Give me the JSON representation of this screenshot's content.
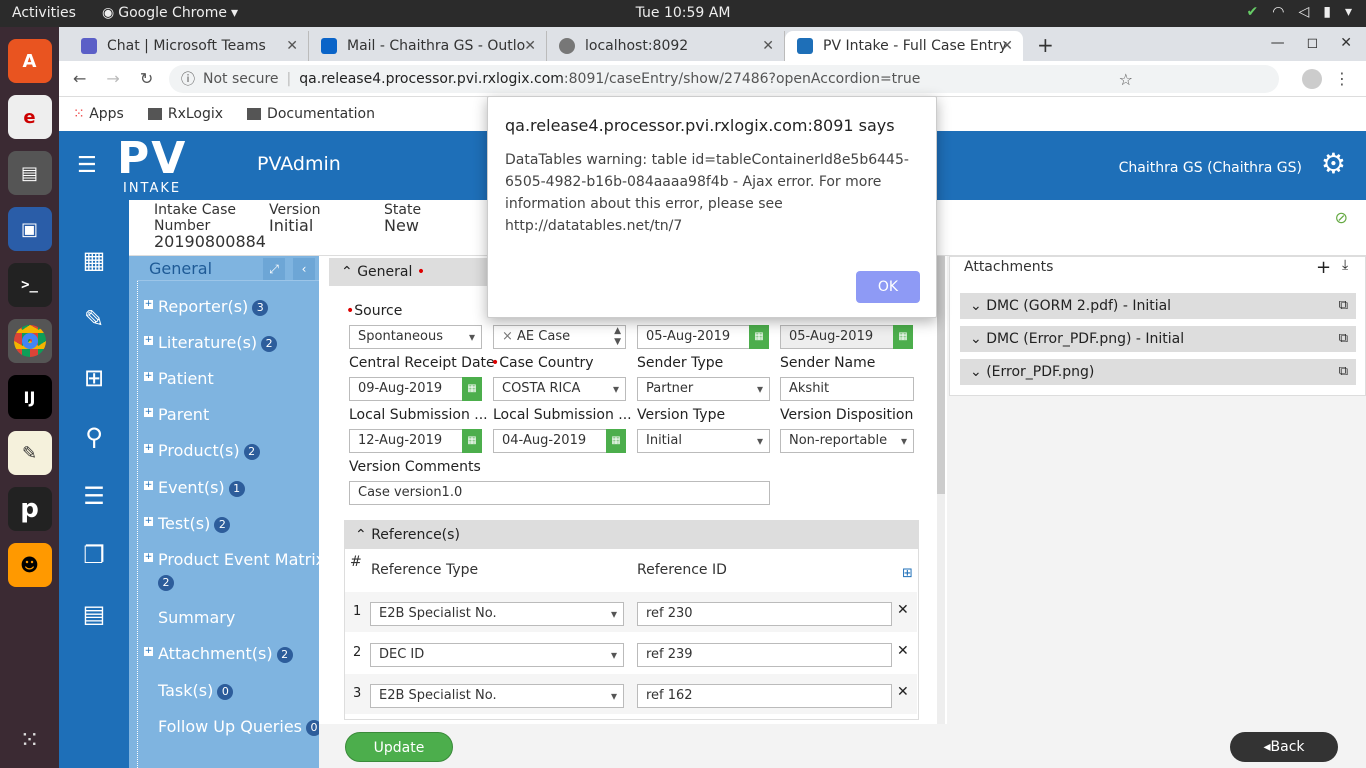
{
  "os": {
    "activities": "Activities",
    "app_name": "Google Chrome",
    "clock": "Tue 10:59 AM"
  },
  "tabs": [
    {
      "label": "Chat | Microsoft Teams"
    },
    {
      "label": "Mail - Chaithra GS - Outlo"
    },
    {
      "label": "localhost:8092"
    },
    {
      "label": "PV Intake - Full Case Entry"
    }
  ],
  "address": {
    "security": "Not secure",
    "url_host": "qa.release4.processor.pvi.rxlogix.com",
    "url_path": ":8091/caseEntry/show/27486?openAccordion=true"
  },
  "bookmarks": [
    "Apps",
    "RxLogix",
    "Documentation"
  ],
  "header": {
    "logo_text": "PV",
    "logo_sub": "INTAKE",
    "app_title": "PVAdmin",
    "user": "Chaithra GS (Chaithra GS)"
  },
  "caseinfo": {
    "intake_label": "Intake Case",
    "intake_label2": "Number",
    "intake_value": "20190800884",
    "version_label": "Version",
    "version_value": "Initial",
    "state_label": "State",
    "state_value": "New"
  },
  "secnav": {
    "title": "General",
    "items": [
      {
        "label": "Reporter(s)",
        "badge": "3"
      },
      {
        "label": "Literature(s)",
        "badge": "2"
      },
      {
        "label": "Patient",
        "badge": ""
      },
      {
        "label": "Parent",
        "badge": ""
      },
      {
        "label": "Product(s)",
        "badge": "2"
      },
      {
        "label": "Event(s)",
        "badge": "1"
      },
      {
        "label": "Test(s)",
        "badge": "2"
      },
      {
        "label": "Product Event Matrix",
        "badge": "2"
      },
      {
        "label": "Summary",
        "badge": ""
      },
      {
        "label": "Attachment(s)",
        "badge": "2"
      },
      {
        "label": "Task(s)",
        "badge": "0"
      },
      {
        "label": "Follow Up Queries",
        "badge": "0"
      }
    ]
  },
  "general": {
    "title": "General",
    "source_label": "Source",
    "source_value": "Spontaneous",
    "category_chip": "AE Case",
    "date1": "05-Aug-2019",
    "date2": "05-Aug-2019",
    "central_receipt_label": "Central Receipt Date",
    "central_receipt_value": "09-Aug-2019",
    "case_country_label": "Case Country",
    "case_country_value": "COSTA RICA",
    "sender_type_label": "Sender Type",
    "sender_type_value": "Partner",
    "sender_name_label": "Sender Name",
    "sender_name_value": "Akshit",
    "local_sub1_label": "Local Submission ...",
    "local_sub1_value": "12-Aug-2019",
    "local_sub2_label": "Local Submission ...",
    "local_sub2_value": "04-Aug-2019",
    "version_type_label": "Version Type",
    "version_type_value": "Initial",
    "version_disp_label": "Version Disposition",
    "version_disp_value": "Non-reportable",
    "version_comments_label": "Version Comments",
    "version_comments_value": "Case version1.0"
  },
  "references": {
    "title": "Reference(s)",
    "col_num": "#",
    "col_type": "Reference Type",
    "col_id": "Reference ID",
    "rows": [
      {
        "n": "1",
        "type": "E2B Specialist No.",
        "id": "ref 230"
      },
      {
        "n": "2",
        "type": "DEC ID",
        "id": "ref 239"
      },
      {
        "n": "3",
        "type": "E2B Specialist No.",
        "id": "ref 162"
      }
    ]
  },
  "attachments": {
    "title": "Attachments",
    "items": [
      {
        "label": "DMC (GORM 2.pdf) - Initial"
      },
      {
        "label": "DMC (Error_PDF.png) - Initial"
      },
      {
        "label": "(Error_PDF.png)"
      }
    ]
  },
  "footer": {
    "update": "Update",
    "back": "Back"
  },
  "dialog": {
    "title": "qa.release4.processor.pvi.rxlogix.com:8091 says",
    "message": "DataTables warning: table id=tableContainerId8e5b6445-6505-4982-b16b-084aaaa98f4b - Ajax error. For more information about this error, please see http://datatables.net/tn/7",
    "ok": "OK"
  }
}
